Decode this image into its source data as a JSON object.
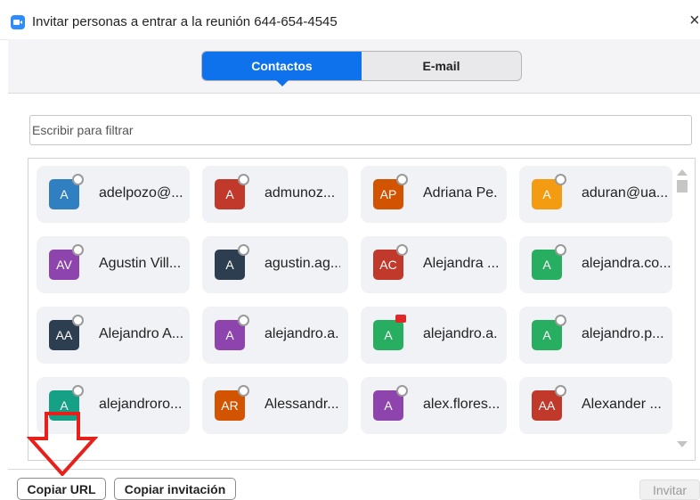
{
  "window": {
    "title": "Invitar personas a entrar a la reunión 644-654-4545",
    "close_glyph": "×",
    "icon": "zoom-app-icon"
  },
  "tabs": [
    {
      "label": "Contactos",
      "active": true
    },
    {
      "label": "E-mail",
      "active": false
    }
  ],
  "filter": {
    "placeholder": "Escribir para filtrar",
    "value": ""
  },
  "contacts": [
    {
      "initials": "A",
      "name": "adelpozo@...",
      "color": "#2f7fc1",
      "status": "offline"
    },
    {
      "initials": "A",
      "name": "admunoz...",
      "color": "#c0392b",
      "status": "offline"
    },
    {
      "initials": "AP",
      "name": "Adriana Pe...",
      "color": "#d35400",
      "status": "offline"
    },
    {
      "initials": "A",
      "name": "aduran@ua...",
      "color": "#f39c12",
      "status": "offline"
    },
    {
      "initials": "AV",
      "name": "Agustin Vill...",
      "color": "#8e44ad",
      "status": "offline"
    },
    {
      "initials": "A",
      "name": "agustin.ag...",
      "color": "#2c3e50",
      "status": "offline"
    },
    {
      "initials": "AC",
      "name": "Alejandra ...",
      "color": "#c0392b",
      "status": "offline"
    },
    {
      "initials": "A",
      "name": "alejandra.co...",
      "color": "#27ae60",
      "status": "offline"
    },
    {
      "initials": "AA",
      "name": "Alejandro A...",
      "color": "#2c3e50",
      "status": "offline"
    },
    {
      "initials": "A",
      "name": "alejandro.a...",
      "color": "#8e44ad",
      "status": "offline"
    },
    {
      "initials": "A",
      "name": "alejandro.a...",
      "color": "#27ae60",
      "status": "video"
    },
    {
      "initials": "A",
      "name": "alejandro.p...",
      "color": "#27ae60",
      "status": "offline"
    },
    {
      "initials": "A",
      "name": "alejandroro...",
      "color": "#16a085",
      "status": "offline"
    },
    {
      "initials": "AR",
      "name": "Alessandr...",
      "color": "#d35400",
      "status": "offline"
    },
    {
      "initials": "A",
      "name": "alex.flores...",
      "color": "#8e44ad",
      "status": "offline"
    },
    {
      "initials": "AA",
      "name": "Alexander ...",
      "color": "#c0392b",
      "status": "offline"
    }
  ],
  "footer": {
    "copy_url": "Copiar URL",
    "copy_invitation": "Copiar invitación",
    "invite": "Invitar"
  },
  "annotation": {
    "arrow_color": "#e8201c",
    "points_to": "Copiar URL"
  }
}
